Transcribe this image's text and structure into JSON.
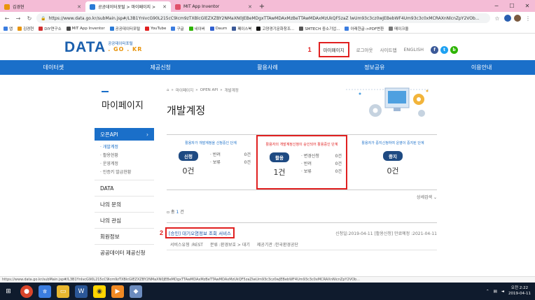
{
  "browser": {
    "tabs": [
      {
        "label": "김경현",
        "color": "#e8940c"
      },
      {
        "label": "공공데이터포털 > 마이페이지 > ",
        "color": "#2a7ad6"
      },
      {
        "label": "MIT App Inventor",
        "color": "#e0506a"
      }
    ],
    "url": "https://www.data.go.kr/subMain.jsp#/L3B1YnIvcG90L215cC9Icm9zTXBlcGlEZXZBY2NMaXN0JEBeMDgxTTAwMDAxMzBeTTAwMDAxMzUkQF5zaZ lwUm93c3cz0wJEBebWF4Um93c3c0xMCRAXnNlcnZpY2VOb...",
    "bookmarks": [
      {
        "label": "앱",
        "color": "#3b7de0"
      },
      {
        "label": "김경현",
        "color": "#e8940c"
      },
      {
        "label": "DIY연구소",
        "color": "#d03030"
      },
      {
        "label": "MIT App Inventor",
        "color": "#444444"
      },
      {
        "label": "공공데이터포털",
        "color": "#2a7ad6"
      },
      {
        "label": "YouTube",
        "color": "#e02020"
      },
      {
        "label": "구글",
        "color": "#3b7de0"
      },
      {
        "label": "네이버",
        "color": "#2db400"
      },
      {
        "label": "Daum",
        "color": "#3060d0"
      },
      {
        "label": "페이스북",
        "color": "#3b5998"
      },
      {
        "label": "고양경기문화창조...",
        "color": "#111111"
      },
      {
        "label": "SMTECH 중소기업...",
        "color": "#555555"
      },
      {
        "label": "아래한글->PDF변환",
        "color": "#3b7de0"
      },
      {
        "label": "메이크올",
        "color": "#777777"
      }
    ]
  },
  "header": {
    "logo_main": "DATA",
    "logo_sub_kr": "공공데이터포털",
    "logo_sub_domain": ". GO . KR",
    "annotation_1": "1",
    "mypage": "마이페이지",
    "logout": "로그아웃",
    "sitemap": "사이트맵",
    "english": "ENGLISH",
    "social": [
      {
        "glyph": "f",
        "color": "#3b5998"
      },
      {
        "glyph": "t",
        "color": "#1da1f2"
      },
      {
        "glyph": "b",
        "color": "#2db400"
      }
    ]
  },
  "nav": [
    "데이터셋",
    "제공신청",
    "활용사례",
    "정보공유",
    "이용안내"
  ],
  "sidebar": {
    "title": "마이페이지",
    "active": "오픈API",
    "active_chevron": "›",
    "subitems": [
      {
        "label": "· 개발계정",
        "current": true
      },
      {
        "label": "· 활용현황",
        "current": false
      },
      {
        "label": "· 운영계정",
        "current": false
      },
      {
        "label": "· 인증키 발급현황",
        "current": false
      }
    ],
    "items": [
      "DATA",
      "나의 문의",
      "나의 관심",
      "회원정보",
      "공공데이터 제공신청"
    ]
  },
  "content": {
    "breadcrumb": [
      "⌂",
      "»",
      "마이페이지",
      "»",
      "OPEN API",
      "»",
      "개발계정"
    ],
    "title": "개발계정",
    "panels": [
      {
        "desc": "활용자가 개발계정을 신청중인 단계",
        "pill": "신청",
        "count": "0건",
        "subs": [
          {
            "label": "· 반려",
            "value": "0건"
          },
          {
            "label": "· 보류",
            "value": "0건"
          }
        ]
      },
      {
        "desc": "활용자의 개발계정신청이 승인되어 활용중인 단계",
        "pill": "활용",
        "count": "1건",
        "subs": [
          {
            "label": "· 변경신청",
            "value": "0건"
          },
          {
            "label": "· 반려",
            "value": "0건"
          },
          {
            "label": "· 보류",
            "value": "0건"
          }
        ]
      },
      {
        "desc": "활용자가 중지신청하여 운영이 중지된 단계",
        "pill": "중지",
        "count": "0건",
        "subs": []
      }
    ],
    "detail_search": "상세검색",
    "total_prefix": "총",
    "total_count": "1",
    "total_suffix": "건",
    "annotation_2": "2",
    "result": {
      "title": "[승인] 대기오염정보 조회 서비스",
      "meta": "신청일:2019-04-11 [활용신청] 만료예정 :2021-04-11",
      "service_type": "서비스유형 :REST",
      "category": "분류 :환경보호 > 대기",
      "provider": "제공기관 :한국환경공단"
    }
  },
  "statusbar": "https://www.data.go.kr/subMain.jsp#/L3B1YnIvcG90L215cC9Icm9zTXBlcGlEZXZBY2NMaXN0JEBeMDgxTTAwMDAxMzBeTTAwMDAxMzUkQF5zaZlwUm93c3cz0wJEBebWF4Um93c3c0xMCRAXnNlcnZpY2VOb...",
  "taskbar": {
    "time": "오전 2:22",
    "date": "2019-04-11"
  }
}
